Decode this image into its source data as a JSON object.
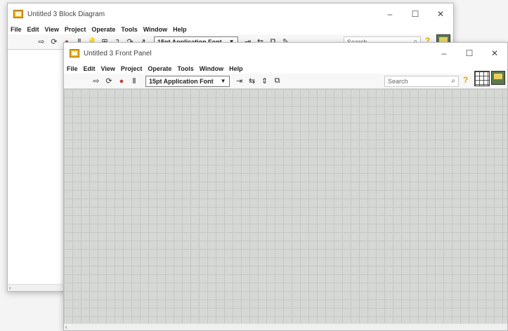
{
  "block_diagram": {
    "title": "Untitled 3 Block Diagram",
    "menu": [
      "File",
      "Edit",
      "View",
      "Project",
      "Operate",
      "Tools",
      "Window",
      "Help"
    ],
    "font_selector": "15pt Application Font",
    "search_placeholder": "Search",
    "controls": {
      "minimize": "–",
      "maximize": "☐",
      "close": "✕"
    }
  },
  "front_panel": {
    "title": "Untitled 3 Front Panel",
    "menu": [
      "File",
      "Edit",
      "View",
      "Project",
      "Operate",
      "Tools",
      "Window",
      "Help"
    ],
    "font_selector": "15pt Application Font",
    "search_placeholder": "Search",
    "controls": {
      "minimize": "–",
      "maximize": "☐",
      "close": "✕"
    }
  },
  "icons": {
    "run": "⇨",
    "run_continuous": "⟳",
    "abort": "●",
    "pause": "Ⅱ",
    "help": "?",
    "search": "🔍"
  },
  "colors": {
    "grid_bg": "#d6d8d6",
    "grid_line": "#c5c7c5",
    "app_icon": "#f0b020"
  }
}
